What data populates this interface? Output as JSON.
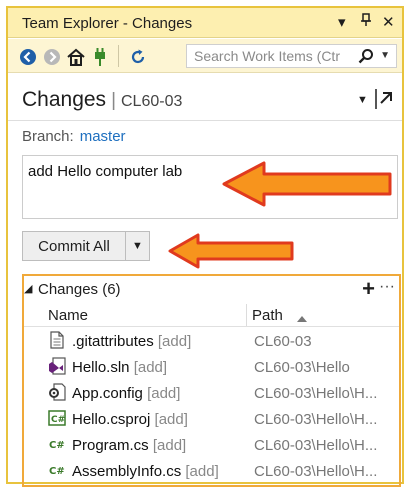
{
  "window": {
    "title": "Team Explorer - Changes",
    "controls": [
      "▾",
      "⊓",
      "✕"
    ]
  },
  "toolbar": {
    "search_placeholder": "Search Work Items (Ctr",
    "icons": [
      "back-icon",
      "forward-icon",
      "home-icon",
      "connect-icon",
      "refresh-icon",
      "search-icon"
    ]
  },
  "header": {
    "title": "Changes",
    "separator": "|",
    "repo": "CL60-03"
  },
  "branch": {
    "label": "Branch:",
    "name": "master"
  },
  "commit": {
    "message": "add Hello computer lab",
    "button": "Commit All"
  },
  "changes": {
    "section_label": "Changes (6)",
    "columns": {
      "name": "Name",
      "path": "Path"
    },
    "rows": [
      {
        "icon": "file-icon",
        "name": ".gitattributes",
        "status": "[add]",
        "path": "CL60-03"
      },
      {
        "icon": "solution-icon",
        "name": "Hello.sln",
        "status": "[add]",
        "path": "CL60-03\\Hello"
      },
      {
        "icon": "config-icon",
        "name": "App.config",
        "status": "[add]",
        "path": "CL60-03\\Hello\\H..."
      },
      {
        "icon": "csproj-icon",
        "name": "Hello.csproj",
        "status": "[add]",
        "path": "CL60-03\\Hello\\H..."
      },
      {
        "icon": "csharp-icon",
        "name": "Program.cs",
        "status": "[add]",
        "path": "CL60-03\\Hello\\H..."
      },
      {
        "icon": "csharp-icon",
        "name": "AssemblyInfo.cs",
        "status": "[add]",
        "path": "CL60-03\\Hello\\H..."
      }
    ]
  },
  "colors": {
    "title_bar": "#fdefb0",
    "frame_border": "#e8c33d",
    "section_border": "#f0a93a",
    "arrow_fill": "#f7941d",
    "arrow_stroke": "#e03a1e",
    "link": "#1e6fbf"
  }
}
